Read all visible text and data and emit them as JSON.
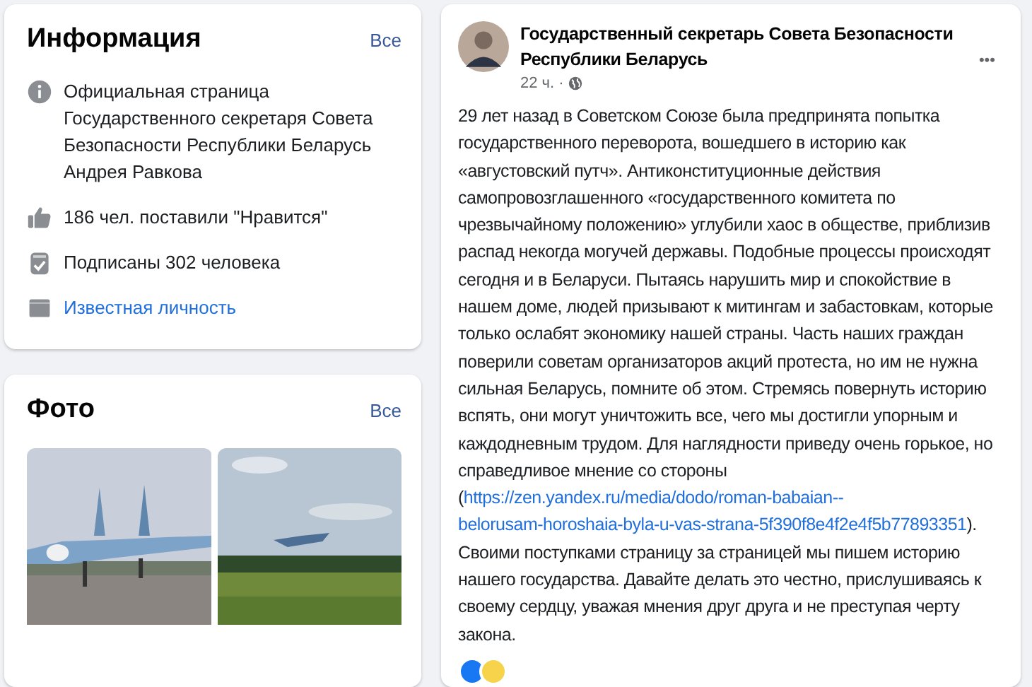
{
  "info_card": {
    "title": "Информация",
    "see_all": "Все",
    "items": [
      {
        "kind": "info",
        "text": "Официальная страница Государственного секретаря Совета Безопасности Республики Беларусь Андрея Равкова"
      },
      {
        "kind": "like",
        "text": "186 чел. поставили \"Нравится\""
      },
      {
        "kind": "follow",
        "text": "Подписаны 302 человека"
      },
      {
        "kind": "category",
        "text": "Известная личность"
      }
    ]
  },
  "photo_card": {
    "title": "Фото",
    "see_all": "Все"
  },
  "post": {
    "author": "Государственный секретарь Совета Безопасности Республики Беларусь",
    "time": "22 ч. ·",
    "menu": "•••",
    "text_before": "29 лет назад в Советском Союзе была предпринята попытка государственного переворота, вошедшего в историю как «августовский путч». Антиконституционные действия самопровозглашенного «государственного комитета по чрезвычайному положению» углубили хаос в обществе, приблизив распад некогда могучей державы. Подобные процессы происходят сегодня и в Беларуси. Пытаясь нарушить мир и спокойствие в нашем доме, людей призывают к митингам и забастовкам, которые только ослабят экономику нашей страны. Часть наших граждан поверили советам организаторов акций протеста, но им не нужна сильная Беларусь, помните об этом. Стремясь повернуть историю вспять, они могут уничтожить все, чего мы достигли упорным и каждодневным трудом. Для наглядности приведу очень горькое, но справедливое мнение со стороны (",
    "link_parts": [
      "https://zen.yandex.ru/media/dodo/roman-babaian--",
      "belorusam-horoshaia-byla-u-vas-strana-5f390f8e4f2e4f5b77893351"
    ],
    "text_after": "). Своими поступками страницу за страницей мы пишем историю нашего государства. Давайте делать это честно, прислушиваясь к своему сердцу, уважая мнения друг друга и не преступая черту закона."
  }
}
